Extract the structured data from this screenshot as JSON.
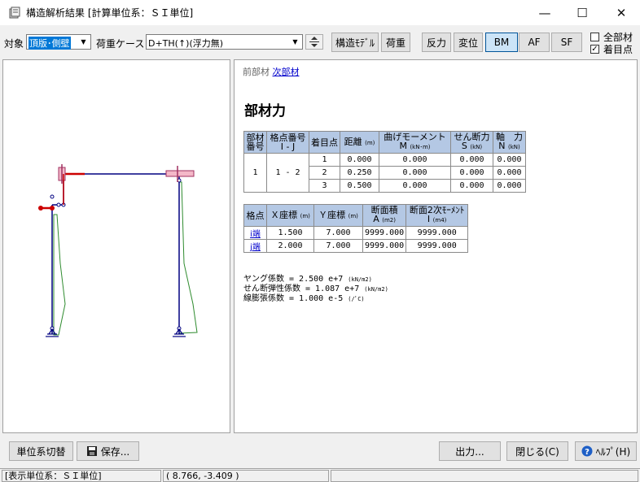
{
  "window": {
    "title": "構造解析結果  [計算単位系：ＳＩ単位]",
    "minimize_glyph": "—",
    "maximize_glyph": "☐",
    "close_glyph": "✕"
  },
  "toolbar": {
    "target_label": "対象",
    "target_value": "頂版･側壁",
    "load_case_label": "荷重ケース",
    "load_case_value": "D+TH(↑)(浮力無)",
    "struct_model_label": "構造ﾓﾃﾞﾙ",
    "load_label": "荷重",
    "reaction_label": "反力",
    "displacement_label": "変位",
    "bm_label": "BM",
    "af_label": "AF",
    "sf_label": "SF",
    "all_members_label": "全部材",
    "all_members_checked": false,
    "focus_point_label": "着目点",
    "focus_point_checked": true,
    "selected_result": "BM"
  },
  "nav": {
    "prev_label": "前部材",
    "next_label": "次部材"
  },
  "section_title": "部材力",
  "member_table": {
    "headers": {
      "member_no": [
        "部材",
        "番号"
      ],
      "node_no": [
        "格点番号",
        "I - J"
      ],
      "focus_point": "着目点",
      "distance": "距離",
      "distance_unit": "(m)",
      "moment": [
        "曲げモーメント",
        "M"
      ],
      "moment_unit": "(kN･m)",
      "shear": [
        "せん断力",
        "S"
      ],
      "shear_unit": "(kN)",
      "axial": [
        "軸　力",
        "N"
      ],
      "axial_unit": "(kN)"
    },
    "member_no": "1",
    "node_ij": "1 - 2",
    "rows": [
      {
        "point": "1",
        "distance": "0.000",
        "moment": "0.000",
        "shear": "0.000",
        "axial": "0.000"
      },
      {
        "point": "2",
        "distance": "0.250",
        "moment": "0.000",
        "shear": "0.000",
        "axial": "0.000"
      },
      {
        "point": "3",
        "distance": "0.500",
        "moment": "0.000",
        "shear": "0.000",
        "axial": "0.000"
      }
    ]
  },
  "node_table": {
    "headers": {
      "node": "格点",
      "x": "Ｘ座標",
      "x_unit": "(m)",
      "y": "Ｙ座標",
      "y_unit": "(m)",
      "area": [
        "断面積",
        "A"
      ],
      "area_unit": "(m2)",
      "inertia": [
        "断面2次ﾓｰﾒﾝﾄ",
        "I"
      ],
      "inertia_unit": "(m4)"
    },
    "rows": [
      {
        "end": "i端",
        "x": "1.500",
        "y": "7.000",
        "area": "9999.000",
        "inertia": "9999.000"
      },
      {
        "end": "j端",
        "x": "2.000",
        "y": "7.000",
        "area": "9999.000",
        "inertia": "9999.000"
      }
    ]
  },
  "properties": [
    {
      "text": "ヤング係数 = 2.500 e+7",
      "unit": "(kN/m2)"
    },
    {
      "text": "せん断弾性係数 = 1.087 e+7",
      "unit": "(kN/m2)"
    },
    {
      "text": "線膨張係数 = 1.000 e-5",
      "unit": "(/ﾟC)"
    }
  ],
  "bottom": {
    "unit_switch_label": "単位系切替",
    "save_label": "保存...",
    "output_label": "出力...",
    "close_label": "閉じる(C)",
    "help_label": "ﾍﾙﾌﾟ(H)"
  },
  "status": {
    "unit_text": "[表示単位系：ＳＩ単位]",
    "coord_text": "(    8.766,   -3.409 )"
  },
  "colors": {
    "frame": "#000080",
    "diagram": "#2e8b2e",
    "highlight": "#cc0000",
    "table_header": "#b4c8e4",
    "link": "#0000cc"
  }
}
